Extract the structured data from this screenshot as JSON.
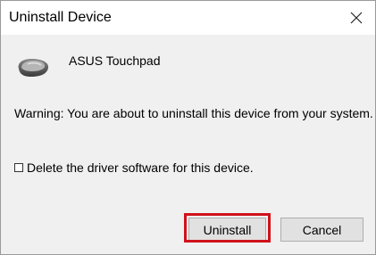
{
  "dialog": {
    "title": "Uninstall Device",
    "close_icon": "close-icon",
    "device_icon": "touchpad-icon",
    "device_name": "ASUS Touchpad",
    "warning": "Warning: You are about to uninstall this device from your system.",
    "checkbox": {
      "label": "Delete the driver software for this device.",
      "checked": false
    },
    "buttons": {
      "uninstall": "Uninstall",
      "cancel": "Cancel"
    },
    "highlight_color": "#d0121b"
  }
}
